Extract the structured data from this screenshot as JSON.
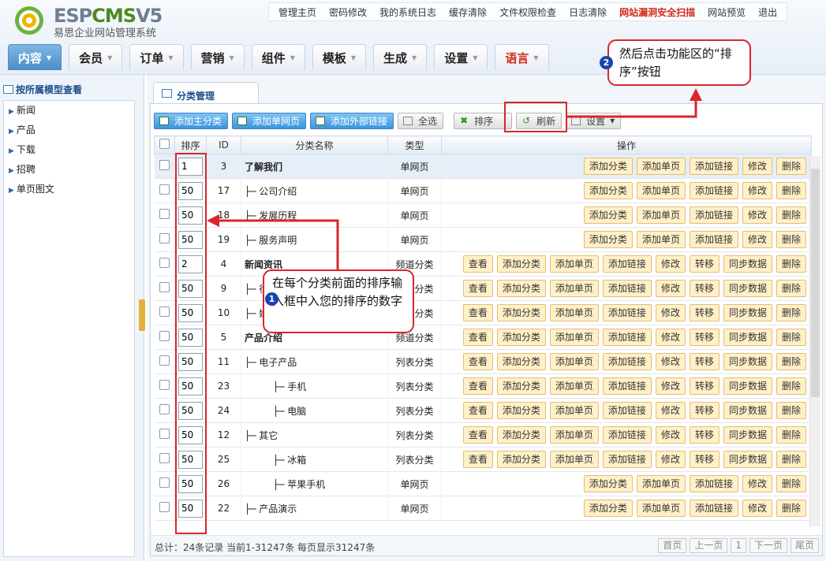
{
  "app": {
    "brand_a": "ESP",
    "brand_b": "CMS",
    "brand_c": "V5",
    "subtitle": "易思企业网站管理系统"
  },
  "topnav": [
    "管理主页",
    "密码修改",
    "我的系统日志",
    "缓存清除",
    "文件权限检查",
    "日志清除",
    "网站漏洞安全扫描",
    "网站预览",
    "退出"
  ],
  "mainnav": [
    "内容",
    "会员",
    "订单",
    "营销",
    "组件",
    "模板",
    "生成",
    "设置",
    "语言"
  ],
  "sidebar": {
    "title": "按所属模型查看",
    "items": [
      "新闻",
      "产品",
      "下载",
      "招聘",
      "单页图文"
    ]
  },
  "tab": {
    "title": "分类管理"
  },
  "toolbar": {
    "add_main": "添加主分类",
    "add_page": "添加单网页",
    "add_link": "添加外部链接",
    "select_all": "全选",
    "sort": "排序",
    "refresh": "刷新",
    "settings": "设置"
  },
  "table": {
    "headers": [
      "排序",
      "ID",
      "分类名称",
      "类型",
      "操作"
    ],
    "rows": [
      {
        "sort": "1",
        "id": "3",
        "name": "了解我们",
        "type": "单网页",
        "bold": true,
        "ops": [
          "添加分类",
          "添加单页",
          "添加链接",
          "修改",
          "删除"
        ]
      },
      {
        "sort": "50",
        "id": "17",
        "name": "├─ 公司介绍",
        "type": "单网页",
        "ops": [
          "添加分类",
          "添加单页",
          "添加链接",
          "修改",
          "删除"
        ]
      },
      {
        "sort": "50",
        "id": "18",
        "name": "├─ 发展历程",
        "type": "单网页",
        "ops": [
          "添加分类",
          "添加单页",
          "添加链接",
          "修改",
          "删除"
        ]
      },
      {
        "sort": "50",
        "id": "19",
        "name": "├─ 服务声明",
        "type": "单网页",
        "ops": [
          "添加分类",
          "添加单页",
          "添加链接",
          "修改",
          "删除"
        ]
      },
      {
        "sort": "2",
        "id": "4",
        "name": "新闻资讯",
        "type": "频道分类",
        "bold": true,
        "ops": [
          "查看",
          "添加分类",
          "添加单页",
          "添加链接",
          "修改",
          "转移",
          "同步数据",
          "删除"
        ]
      },
      {
        "sort": "50",
        "id": "9",
        "name": "├─ 行业新闻",
        "type": "列表分类",
        "ops": [
          "查看",
          "添加分类",
          "添加单页",
          "添加链接",
          "修改",
          "转移",
          "同步数据",
          "删除"
        ]
      },
      {
        "sort": "50",
        "id": "10",
        "name": "├─ 媒体报道",
        "type": "列表分类",
        "ops": [
          "查看",
          "添加分类",
          "添加单页",
          "添加链接",
          "修改",
          "转移",
          "同步数据",
          "删除"
        ]
      },
      {
        "sort": "50",
        "id": "5",
        "name": "产品介绍",
        "type": "频道分类",
        "bold": true,
        "ops": [
          "查看",
          "添加分类",
          "添加单页",
          "添加链接",
          "修改",
          "转移",
          "同步数据",
          "删除"
        ]
      },
      {
        "sort": "50",
        "id": "11",
        "name": "├─ 电子产品",
        "type": "列表分类",
        "ops": [
          "查看",
          "添加分类",
          "添加单页",
          "添加链接",
          "修改",
          "转移",
          "同步数据",
          "删除"
        ]
      },
      {
        "sort": "50",
        "id": "23",
        "name": "├─ 手机",
        "type": "列表分类",
        "indent": 2,
        "ops": [
          "查看",
          "添加分类",
          "添加单页",
          "添加链接",
          "修改",
          "转移",
          "同步数据",
          "删除"
        ]
      },
      {
        "sort": "50",
        "id": "24",
        "name": "├─ 电脑",
        "type": "列表分类",
        "indent": 2,
        "ops": [
          "查看",
          "添加分类",
          "添加单页",
          "添加链接",
          "修改",
          "转移",
          "同步数据",
          "删除"
        ]
      },
      {
        "sort": "50",
        "id": "12",
        "name": "├─ 其它",
        "type": "列表分类",
        "ops": [
          "查看",
          "添加分类",
          "添加单页",
          "添加链接",
          "修改",
          "转移",
          "同步数据",
          "删除"
        ]
      },
      {
        "sort": "50",
        "id": "25",
        "name": "├─ 冰箱",
        "type": "列表分类",
        "indent": 2,
        "ops": [
          "查看",
          "添加分类",
          "添加单页",
          "添加链接",
          "修改",
          "转移",
          "同步数据",
          "删除"
        ]
      },
      {
        "sort": "50",
        "id": "26",
        "name": "├─ 苹果手机",
        "type": "单网页",
        "indent": 2,
        "ops": [
          "添加分类",
          "添加单页",
          "添加链接",
          "修改",
          "删除"
        ]
      },
      {
        "sort": "50",
        "id": "22",
        "name": "├─ 产品演示",
        "type": "单网页",
        "ops": [
          "添加分类",
          "添加单页",
          "添加链接",
          "修改",
          "删除"
        ]
      }
    ]
  },
  "footer": {
    "total": "总计：24条记录 当前1-31247条 每页显示31247条",
    "pager": [
      "首页",
      "上一页",
      "1",
      "下一页",
      "尾页"
    ]
  },
  "annotations": {
    "step1": "在每个分类前面的排序输入框中入您的排序的数字",
    "step2": "然后点击功能区的“排序”按钮",
    "n1": "1",
    "n2": "2"
  },
  "colors": {
    "accent": "#d8272b",
    "nav_active": "#4b8ec9",
    "link": "#1a5fbf",
    "channel": "#3a8a2a"
  }
}
